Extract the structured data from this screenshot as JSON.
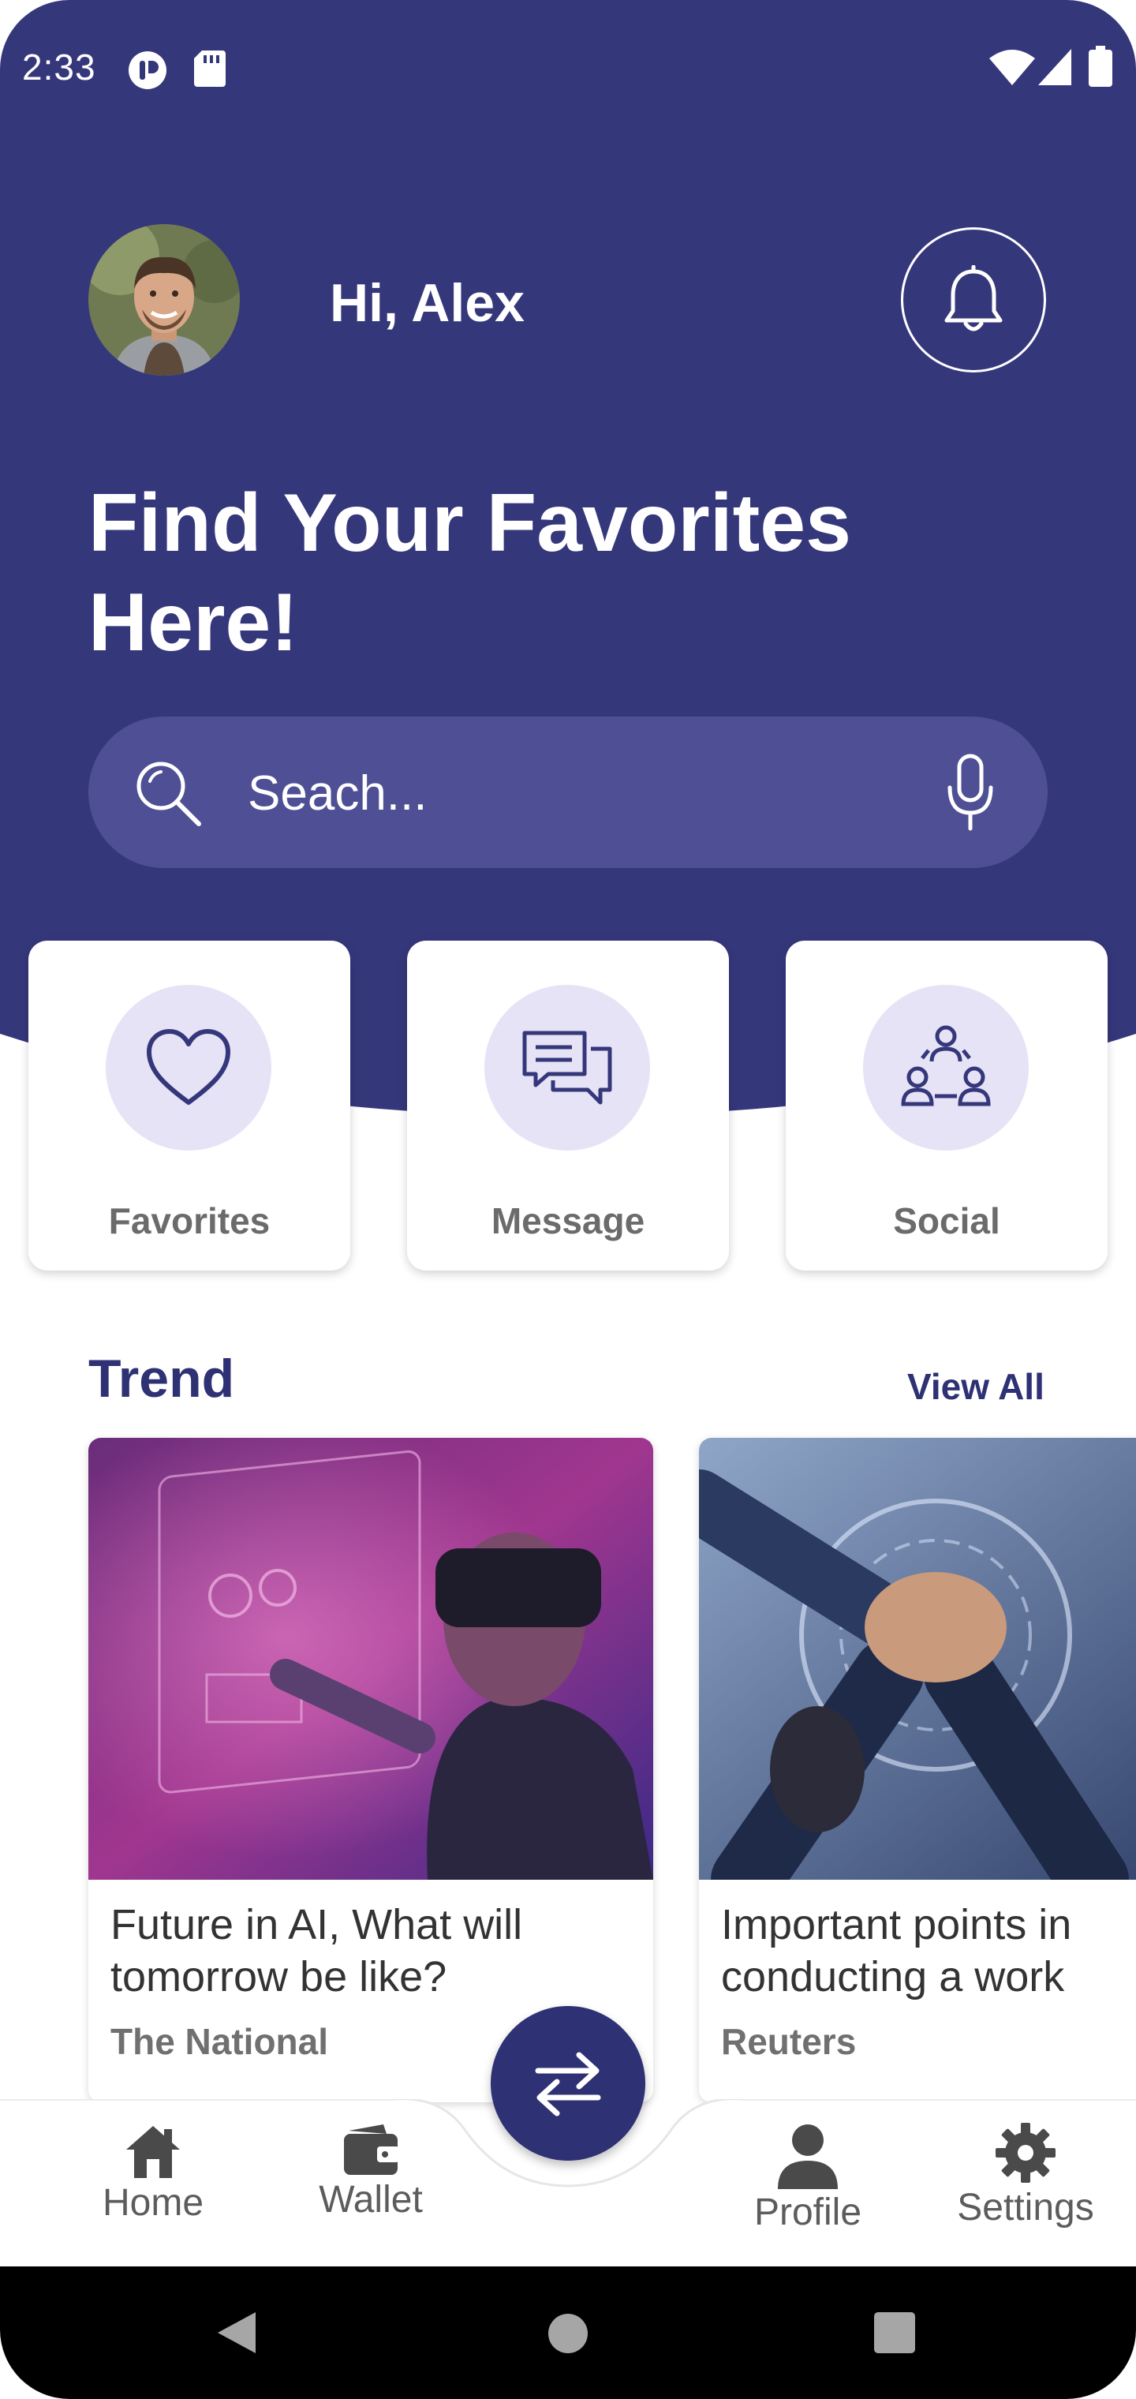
{
  "status_bar": {
    "time": "2:33"
  },
  "header": {
    "greeting": "Hi, Alex",
    "title": "Find Your Favorites Here!",
    "avatar_icon": "user-avatar",
    "notification_icon": "bell-icon"
  },
  "search": {
    "placeholder": "Seach...",
    "search_icon": "magnifier-icon",
    "voice_icon": "microphone-icon"
  },
  "categories": [
    {
      "label": "Favorites",
      "icon": "heart-icon"
    },
    {
      "label": "Message",
      "icon": "chat-bubbles-icon"
    },
    {
      "label": "Social",
      "icon": "people-network-icon"
    }
  ],
  "trend": {
    "title": "Trend",
    "view_all": "View All",
    "items": [
      {
        "headline": "Future in AI, What will tomorrow be like?",
        "source": "The National",
        "image": "vr-headset-person"
      },
      {
        "headline": "Important points in conducting a work",
        "source": "Reuters",
        "image": "team-hands-together"
      }
    ]
  },
  "bottom_nav": {
    "items": [
      {
        "label": "Home",
        "icon": "home-icon"
      },
      {
        "label": "Wallet",
        "icon": "wallet-icon"
      },
      {
        "label": "Profile",
        "icon": "person-icon"
      },
      {
        "label": "Settings",
        "icon": "gear-icon"
      }
    ],
    "fab_icon": "swap-arrows-icon"
  },
  "colors": {
    "primary": "#35377b",
    "primary_light": "#4e4f95",
    "accent_circle": "#e7e3f6",
    "title_dark": "#2e3173",
    "nav_text": "#5c5c5c"
  }
}
